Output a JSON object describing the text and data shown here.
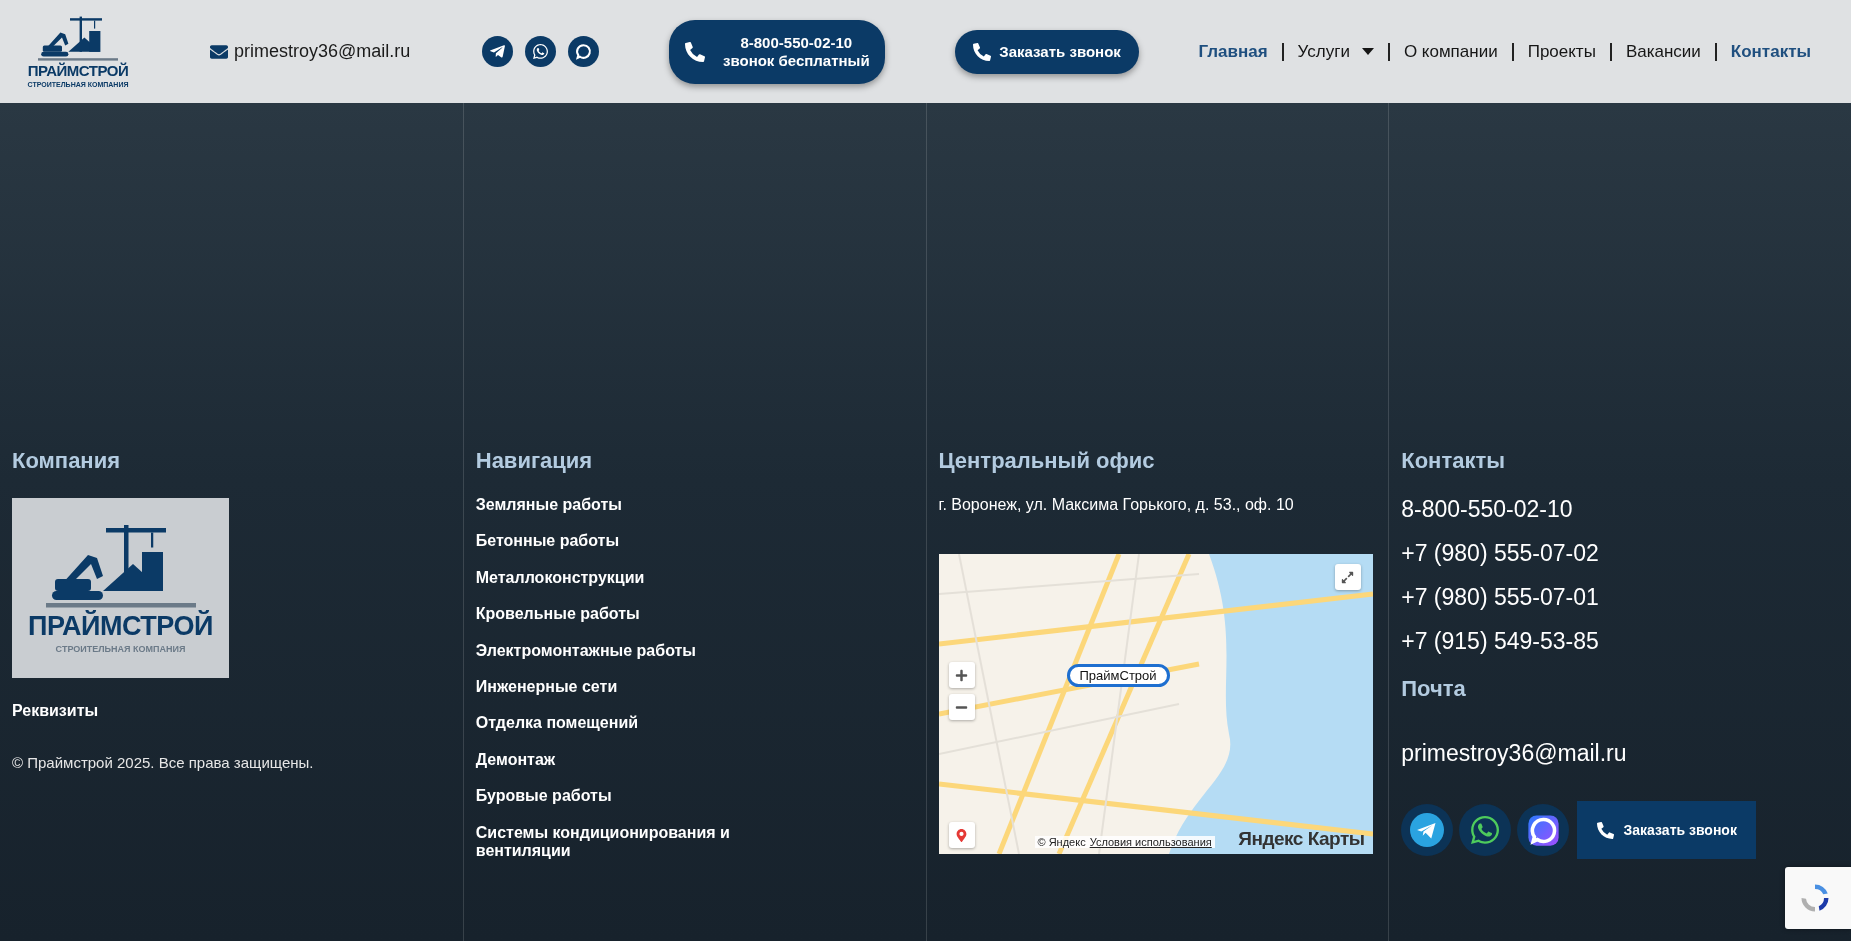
{
  "header": {
    "logo": {
      "name": "ПРАЙМСТРОЙ",
      "tagline": "СТРОИТЕЛЬНАЯ КОМПАНИЯ"
    },
    "email": "primestroy36@mail.ru",
    "socials": [
      {
        "kind": "telegram"
      },
      {
        "kind": "whatsapp"
      },
      {
        "kind": "max"
      }
    ],
    "phone_button": {
      "number": "8-800-550-02-10",
      "note": "звонок бесплатный"
    },
    "callback_button": "Заказать звонок",
    "nav": [
      {
        "label": "Главная",
        "selected": true,
        "has_menu": false
      },
      {
        "label": "Услуги",
        "selected": false,
        "has_menu": true
      },
      {
        "label": "О компании",
        "selected": false,
        "has_menu": false
      },
      {
        "label": "Проекты",
        "selected": false,
        "has_menu": false
      },
      {
        "label": "Вакансии",
        "selected": false,
        "has_menu": false
      },
      {
        "label": "Контакты",
        "selected": true,
        "has_menu": false
      }
    ]
  },
  "footer": {
    "company": {
      "heading": "Компания",
      "logo": {
        "name": "ПРАЙМСТРОЙ",
        "tagline": "СТРОИТЕЛЬНАЯ КОМПАНИЯ"
      },
      "requisites_link": "Реквизиты",
      "copyright": "© Праймстрой 2025. Все права защищены."
    },
    "navigation": {
      "heading": "Навигация",
      "links": [
        "Земляные работы",
        "Бетонные работы",
        "Металлоконструкции",
        "Кровельные работы",
        "Электромонтажные работы",
        "Инженерные сети",
        "Отделка помещений",
        "Демонтаж",
        "Буровые работы",
        "Системы кондиционирования и вентиляции"
      ]
    },
    "office": {
      "heading": "Центральный офис",
      "address": "г. Воронеж, ул. Максима Горького, д. 53., оф. 10",
      "map": {
        "placemark": "ПраймСтрой",
        "copyright": "© Яндекс",
        "terms_link": "Условия использования",
        "brand": "Яндекс Карты"
      }
    },
    "contacts": {
      "heading": "Контакты",
      "phones": [
        "8-800-550-02-10",
        "+7 (980) 555-07-02",
        "+7 (980) 555-07-01",
        "+7 (915) 549-53-85"
      ],
      "mail_heading": "Почта",
      "email": "primestroy36@mail.ru",
      "socials": [
        {
          "kind": "telegram"
        },
        {
          "kind": "whatsapp"
        },
        {
          "kind": "max"
        }
      ],
      "callback_button": "Заказать звонок"
    }
  }
}
